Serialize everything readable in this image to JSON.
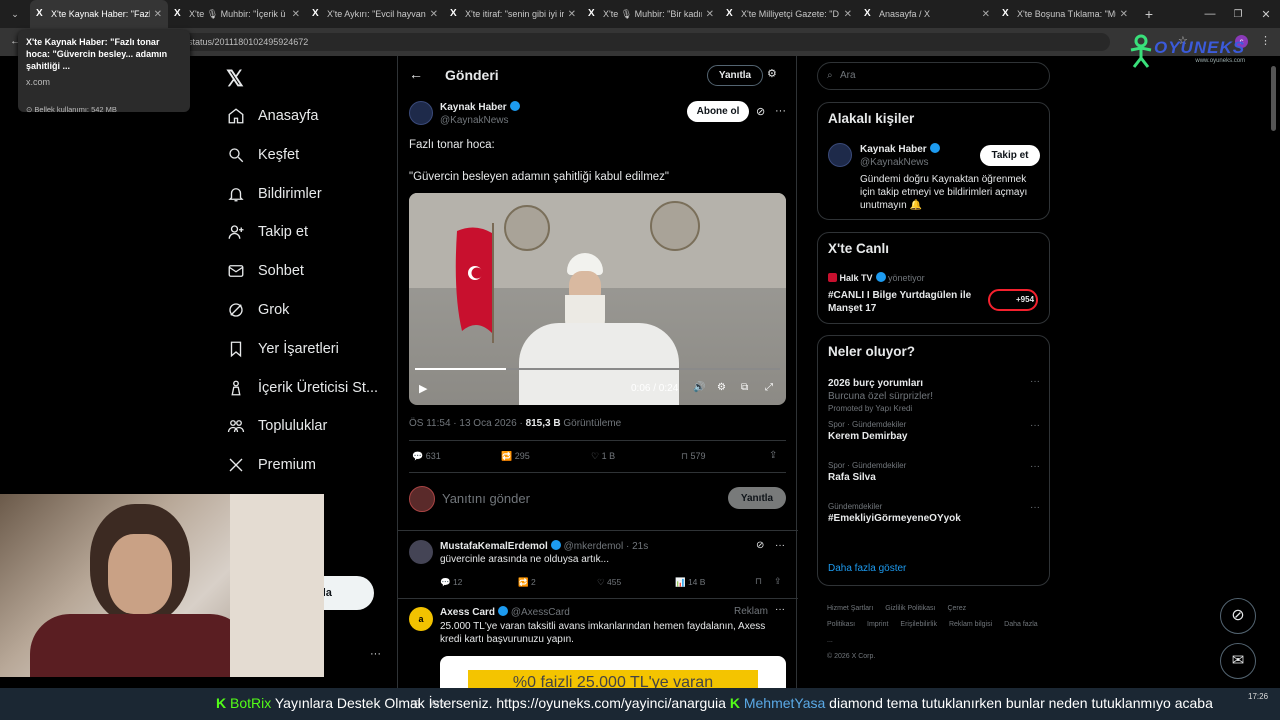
{
  "browser": {
    "tabs": [
      {
        "label": "X'te Kaynak Haber: \"Fazlı t",
        "active": true
      },
      {
        "label": "X'te 🎙 Muhbir: \"İçerik ü",
        "active": false
      },
      {
        "label": "X'te Aykırı: \"Evcil hayvanla",
        "active": false
      },
      {
        "label": "X'te itiraf: \"senin gibi iyi ir",
        "active": false
      },
      {
        "label": "X'te 🎙 Muhbir: \"Bir kadın",
        "active": false
      },
      {
        "label": "X'te Milliyetçi Gazete: \"D",
        "active": false
      },
      {
        "label": "Anasayfa / X",
        "active": false
      },
      {
        "label": "X'te Boşuna Tıklama: \"Mu",
        "active": false
      }
    ],
    "url": "status/2011180102495924672",
    "tooltip": {
      "title": "X'te Kaynak Haber: \"Fazlı tonar hoca: \"Güvercin besley... adamın şahitliği ...",
      "domain": "x.com",
      "memory": "Bellek kullanımı: 542 MB"
    },
    "overlay_logo": "OYUNEKS",
    "overlay_logo_sub": "www.oyuneks.com"
  },
  "sidebar": {
    "items": [
      {
        "label": "Anasayfa",
        "icon": "home-icon"
      },
      {
        "label": "Keşfet",
        "icon": "search-icon"
      },
      {
        "label": "Bildirimler",
        "icon": "bell-icon"
      },
      {
        "label": "Takip et",
        "icon": "person-add-icon"
      },
      {
        "label": "Sohbet",
        "icon": "mail-icon"
      },
      {
        "label": "Grok",
        "icon": "grok-icon"
      },
      {
        "label": "Yer İşaretleri",
        "icon": "bookmark-icon"
      },
      {
        "label": "İçerik Üreticisi St...",
        "icon": "creator-icon"
      },
      {
        "label": "Topluluklar",
        "icon": "communities-icon"
      },
      {
        "label": "Premium",
        "icon": "x-logo-icon"
      }
    ],
    "post_button_partial": "nla"
  },
  "post": {
    "header_title": "Gönderi",
    "reply_button": "Yanıtla",
    "author_name": "Kaynak Haber",
    "author_handle": "@KaynakNews",
    "subscribe_button": "Abone ol",
    "text_line1": "Fazlı tonar hoca:",
    "text_line2": "\"Güvercin besleyen adamın şahitliği kabul edilmez\"",
    "video_time": "0:06 / 0:24",
    "video_progress": 0.25,
    "timestamp": "ÖS 11:54 · 13 Oca 2026 · ",
    "views": "815,3 B",
    "views_label": "Görüntüleme",
    "stats": {
      "replies": "631",
      "reposts": "295",
      "likes": "1 B",
      "bookmarks": "579"
    },
    "compose_placeholder": "Yanıtını gönder",
    "compose_button": "Yanıtla"
  },
  "replies": [
    {
      "name": "MustafaKemalErdemol",
      "handle": "@mkerdemol · 21s",
      "text": "güvercinle arasında ne olduysa artık...",
      "replies": "12",
      "reposts": "2",
      "likes": "455",
      "views": "14 B"
    },
    {
      "name": "Axess Card",
      "handle": "@AxessCard",
      "ad_label": "Reklam",
      "text": "25.000 TL'ye varan taksitli avans imkanlarından hemen faydalanın, Axess kredi kartı başvurunuzu yapın.",
      "banner": "%0 faizli 25.000 TL'ye varan"
    }
  ],
  "right": {
    "search_placeholder": "Ara",
    "related_title": "Alakalı kişiler",
    "related": {
      "name": "Kaynak Haber",
      "handle": "@KaynakNews",
      "follow_button": "Takip et",
      "bio": "Gündemi doğru Kaynaktan öğrenmek için takip etmeyi ve bildirimleri açmayı unutmayın 🔔"
    },
    "live_title": "X'te Canlı",
    "live": {
      "host": "Halk TV",
      "host_suffix": "yönetiyor",
      "title": "#CANLI I Bilge Yurtdagülen ile Manşet 17",
      "count": "+954"
    },
    "trends_title": "Neler oluyor?",
    "trends": [
      {
        "context": "",
        "title": "2026 burç yorumları",
        "sub": "Burcuna özel sürprizler!",
        "promo": "Promoted by Yapı Kredi"
      },
      {
        "context": "Spor · Gündemdekiler",
        "title": "Kerem Demirbay",
        "sub": "",
        "promo": ""
      },
      {
        "context": "Spor · Gündemdekiler",
        "title": "Rafa Silva",
        "sub": "",
        "promo": ""
      },
      {
        "context": "Gündemdekiler",
        "title": "#EmekliyiGörmeyeneOYyok",
        "sub": "",
        "promo": ""
      }
    ],
    "show_more": "Daha fazla göster",
    "footer": [
      "Hizmet Şartları",
      "Gizlilik Politikası",
      "Çerez Politikası",
      "Imprint",
      "Erişilebilirlik",
      "Reklam bilgisi",
      "Daha fazla ...",
      "© 2026 X Corp."
    ]
  },
  "ticker": {
    "prefix": "BotRix",
    "text": "Yayınlara Destek Olmak İsterseniz. https://oyuneks.com/yayinci/anarguia",
    "user": "MehmetYasa",
    "text2": "diamond tema tutuklanırken bunlar neden tutuklanmıyo acaba",
    "search_partial": "Ara",
    "time": "17:26"
  },
  "colors": {
    "x_blue": "#1d9bf0",
    "bg": "#000000",
    "border": "#2f3336",
    "muted": "#71767b"
  }
}
